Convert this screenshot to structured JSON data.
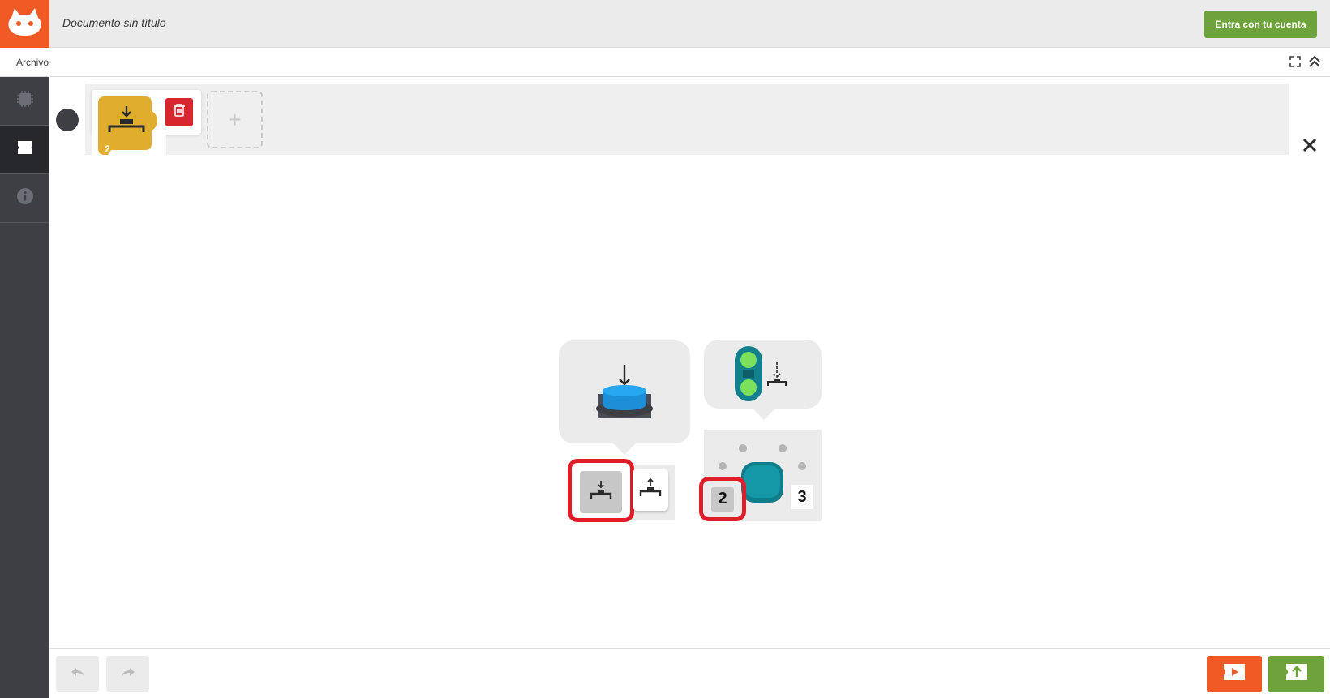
{
  "app": {
    "document_title": "Documento sin título",
    "login_button": "Entra con tu cuenta"
  },
  "menu": {
    "items": [
      {
        "label": "Archivo"
      }
    ]
  },
  "sidebar": {
    "items": [
      {
        "icon": "hardware-board-icon",
        "active": false
      },
      {
        "icon": "software-blocks-icon",
        "active": true
      },
      {
        "icon": "info-icon",
        "active": false
      }
    ]
  },
  "program": {
    "block": {
      "icon": "button-press-icon",
      "port": "2",
      "color": "#e0ae2c"
    }
  },
  "panel": {
    "event_options": [
      {
        "icon": "button-press-icon",
        "selected": true
      },
      {
        "icon": "button-release-icon",
        "selected": false
      }
    ],
    "ports": [
      {
        "label": "2",
        "selected": true
      },
      {
        "label": "3",
        "selected": false
      }
    ]
  },
  "colors": {
    "brand_orange": "#f15a24",
    "accent_green": "#6da33a",
    "highlight_red": "#e01e2a",
    "block_yellow": "#e0ae2c",
    "sidebar_dark": "#3d3f45"
  }
}
